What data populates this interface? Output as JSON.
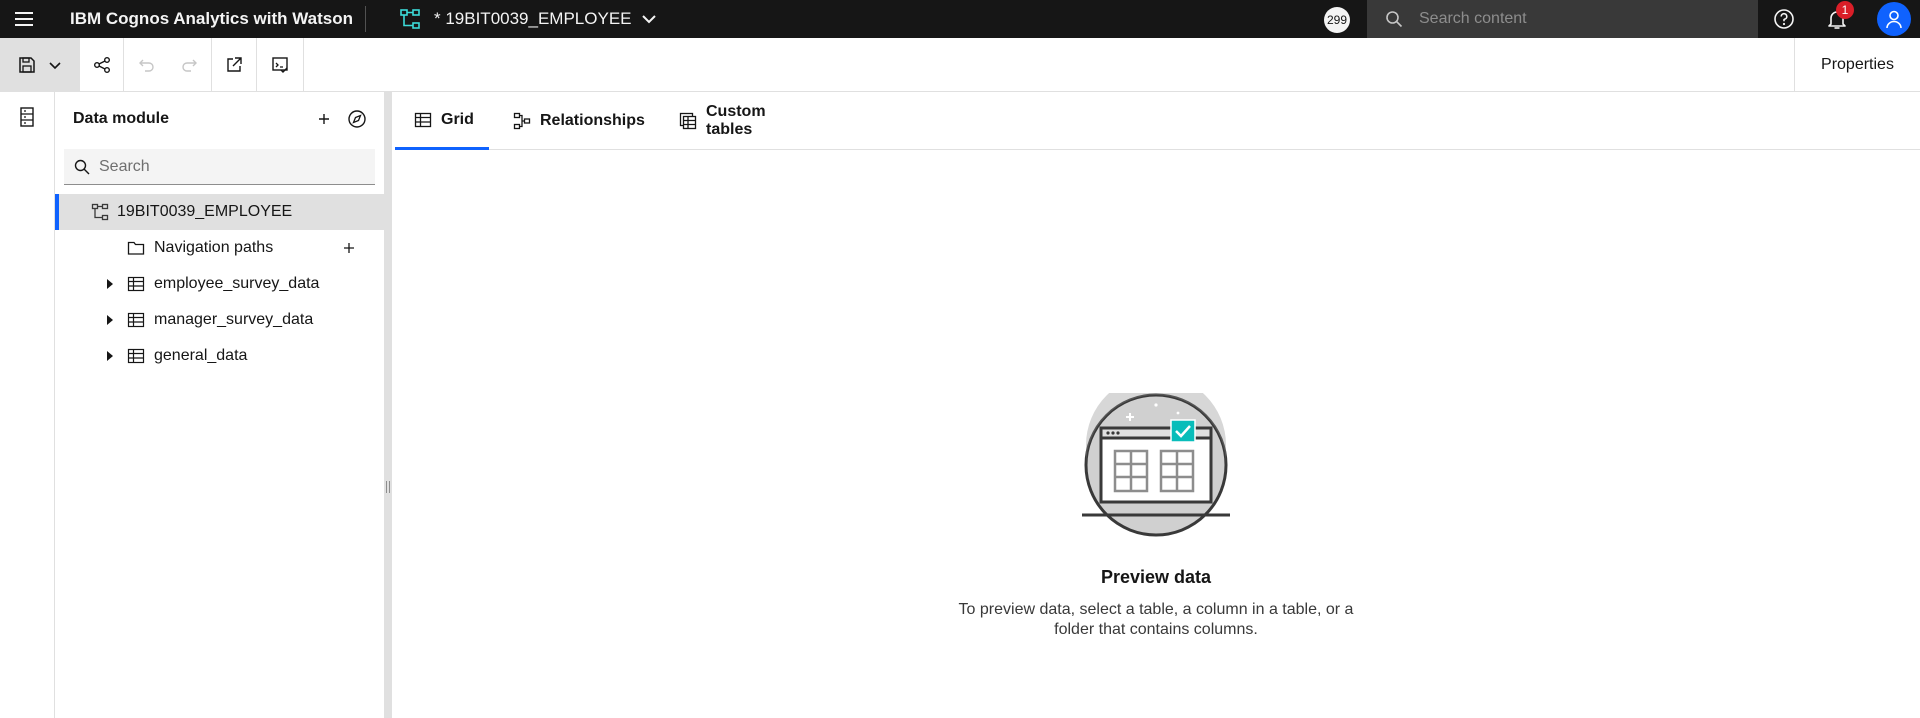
{
  "topbar": {
    "app_title": "IBM Cognos Analytics with Watson",
    "document_title": "* 19BIT0039_EMPLOYEE",
    "counter": "299",
    "search_placeholder": "Search content",
    "notification_count": "1"
  },
  "toolbar": {
    "properties_label": "Properties"
  },
  "panel": {
    "title": "Data module",
    "search_placeholder": "Search",
    "root": "19BIT0039_EMPLOYEE",
    "items": [
      {
        "label": "Navigation paths",
        "icon": "folder-icon"
      },
      {
        "label": "employee_survey_data",
        "icon": "table-icon"
      },
      {
        "label": "manager_survey_data",
        "icon": "table-icon"
      },
      {
        "label": "general_data",
        "icon": "table-icon"
      }
    ]
  },
  "tabs": [
    {
      "label": "Grid",
      "active": true
    },
    {
      "label": "Relationships",
      "active": false
    },
    {
      "label": "Custom tables",
      "active": false
    }
  ],
  "empty_state": {
    "title": "Preview data",
    "text": "To preview data, select a table, a column in a table, or a folder that contains columns."
  },
  "colors": {
    "accent": "#0f62fe",
    "topbar_bg": "#161616",
    "badge": "#da1e28",
    "check_teal": "#08bdba"
  }
}
